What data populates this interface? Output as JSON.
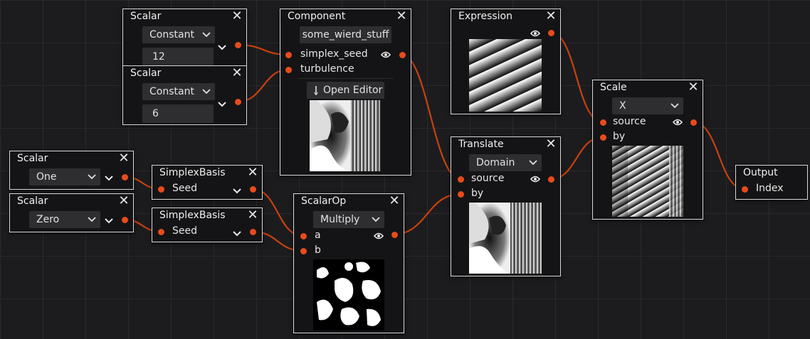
{
  "nodes": {
    "scalar_constant_12": {
      "title": "Scalar",
      "mode": "Constant",
      "value": "12"
    },
    "scalar_constant_6": {
      "title": "Scalar",
      "mode": "Constant",
      "value": "6"
    },
    "component": {
      "title": "Component",
      "name": "some_wierd_stuff",
      "inputs": [
        "simplex_seed",
        "turbulence"
      ],
      "button": "Open Editor"
    },
    "expression": {
      "title": "Expression"
    },
    "scale": {
      "title": "Scale",
      "axis": "X",
      "inputs": [
        "source",
        "by"
      ]
    },
    "scalar_one": {
      "title": "Scalar",
      "mode": "One"
    },
    "scalar_zero": {
      "title": "Scalar",
      "mode": "Zero"
    },
    "simplex_basis_1": {
      "title": "SimplexBasis",
      "input": "Seed"
    },
    "simplex_basis_2": {
      "title": "SimplexBasis",
      "input": "Seed"
    },
    "scalar_op": {
      "title": "ScalarOp",
      "op": "Multiply",
      "inputs": [
        "a",
        "b"
      ]
    },
    "translate": {
      "title": "Translate",
      "mode": "Domain",
      "inputs": [
        "source",
        "by"
      ]
    },
    "output": {
      "title": "Output",
      "input": "Index"
    }
  },
  "icons": {
    "close": "close-icon",
    "visibility": "eye-icon",
    "expand": "chevron-down-icon",
    "edit": "pencil-icon",
    "dropdown": "dropdown-arrow-icon"
  },
  "colors": {
    "background": "#1c1c1e",
    "grid": "#2a2a2d",
    "node_bg": "#141416",
    "node_border": "#d8d8d8",
    "control_bg": "#2e2e31",
    "port": "#e84b1c",
    "wire": "#c8410f"
  }
}
